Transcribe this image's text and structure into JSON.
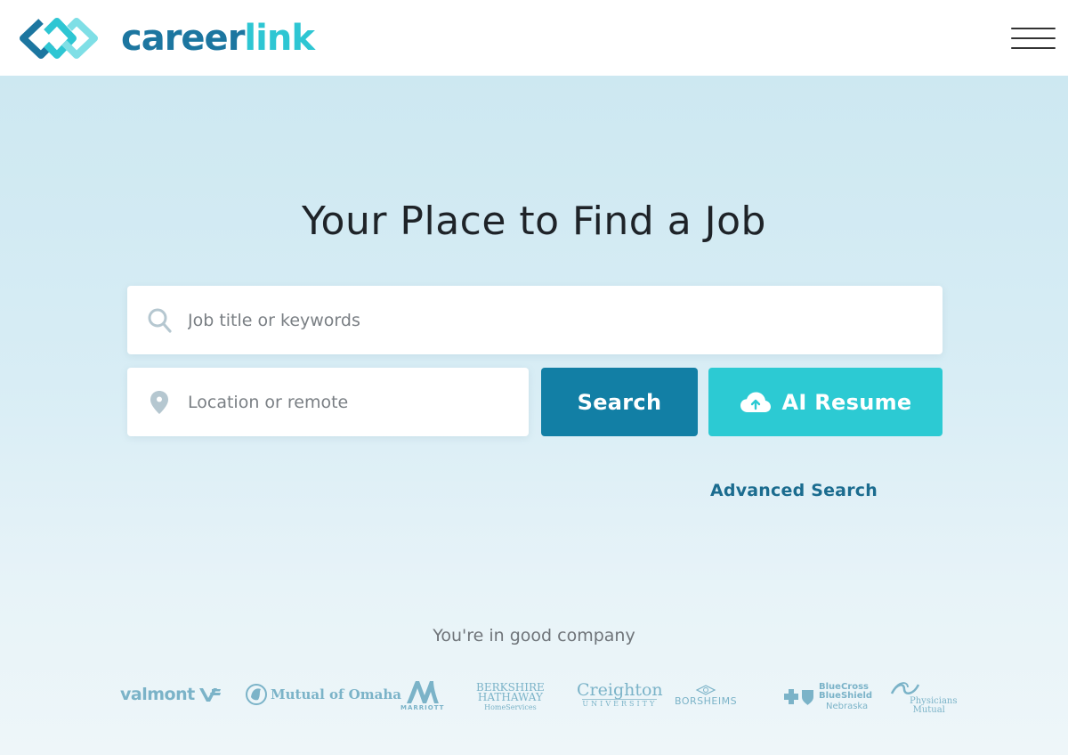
{
  "header": {
    "brand_part1": "career",
    "brand_part2": "link",
    "menu_icon": "hamburger-menu-icon"
  },
  "hero": {
    "title": "Your Place to Find a Job",
    "keyword_input": {
      "placeholder": "Job title or keywords",
      "value": "",
      "icon": "search-icon"
    },
    "location_input": {
      "placeholder": "Location or remote",
      "value": "",
      "icon": "location-pin-icon"
    },
    "search_button": "Search",
    "ai_resume_button": {
      "label": "AI Resume",
      "icon": "cloud-upload-icon"
    },
    "advanced_search": "Advanced Search"
  },
  "companies": {
    "heading": "You're in good company",
    "logos": [
      {
        "name": "valmont",
        "text": "valmont"
      },
      {
        "name": "mutual-of-omaha",
        "text": "Mutual of Omaha"
      },
      {
        "name": "marriott",
        "text": "MARRIOTT"
      },
      {
        "name": "berkshire-hathaway",
        "line1": "BERKSHIRE",
        "line2": "HATHAWAY",
        "line3": "HomeServices"
      },
      {
        "name": "creighton",
        "line1": "Creighton",
        "line2": "UNIVERSITY"
      },
      {
        "name": "borsheims",
        "text": "BORSHEIMS"
      },
      {
        "name": "bcbs-nebraska",
        "line1": "BlueCross",
        "line2": "BlueShield",
        "line3": "Nebraska"
      },
      {
        "name": "physicians-mutual",
        "line1": "Physicians",
        "line2": "Mutual"
      }
    ]
  },
  "colors": {
    "brand_dark": "#1c76a0",
    "brand_light": "#2ec6d3",
    "search_button": "#127fa5",
    "ai_button": "#2ccad3",
    "link": "#1b6c8f",
    "logo_gray_blue": "#7bb3c8"
  }
}
